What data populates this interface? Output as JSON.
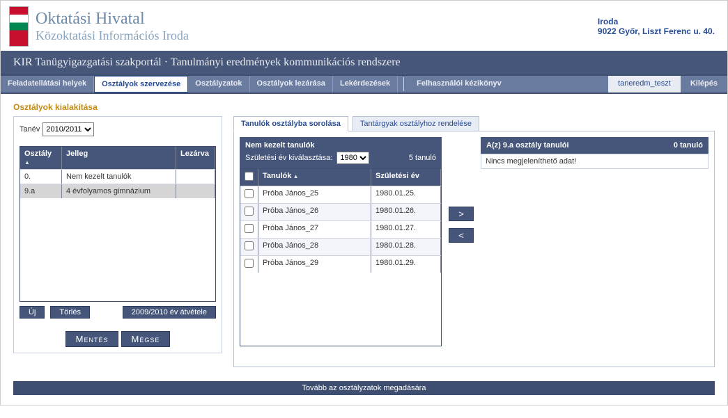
{
  "header": {
    "title": "Oktatási Hivatal",
    "subtitle": "Közoktatási Információs Iroda",
    "dept": "Iroda",
    "address": "9022 Győr, Liszt Ferenc u. 40."
  },
  "crumb": "KIR Tanügyigazgatási szakportál · Tanulmányi eredmények kommunikációs rendszere",
  "nav": {
    "items": [
      "Feladatellátási helyek",
      "Osztályok szervezése",
      "Osztályzatok",
      "Osztályok lezárása",
      "Lekérdezések",
      "Felhasználói kézikönyv"
    ],
    "active_index": 1,
    "user": "taneredm_teszt",
    "logout": "Kilépés"
  },
  "section_title": "Osztályok kialakítása",
  "year": {
    "label": "Tanév",
    "value": "2010/2011",
    "options": [
      "2010/2011"
    ]
  },
  "class_grid": {
    "headers": [
      "Osztály",
      "Jelleg",
      "Lezárva"
    ],
    "rows": [
      {
        "class": "0.",
        "type": "Nem kezelt tanulók",
        "closed": ""
      },
      {
        "class": "9.a",
        "type": "4 évfolyamos gimnázium",
        "closed": ""
      }
    ],
    "selected_index": 1
  },
  "class_buttons": {
    "new": "Új",
    "delete": "Törlés",
    "import": "2009/2010 év átvétele"
  },
  "save_buttons": {
    "save": "Mentés",
    "cancel": "Mégse"
  },
  "tabs": {
    "items": [
      "Tanulók osztályba sorolása",
      "Tantárgyak osztályhoz rendelése"
    ],
    "active_index": 0
  },
  "students_panel": {
    "title": "Nem kezelt tanulók",
    "birth_label": "Születési év kiválasztása:",
    "birth_value": "1980",
    "birth_options": [
      "1980"
    ],
    "count_text": "5 tanuló",
    "headers": [
      "Tanulók",
      "Születési év"
    ],
    "rows": [
      {
        "name": "Próba János_25",
        "dob": "1980.01.25."
      },
      {
        "name": "Próba János_26",
        "dob": "1980.01.26."
      },
      {
        "name": "Próba János_27",
        "dob": "1980.01.27."
      },
      {
        "name": "Próba János_28",
        "dob": "1980.01.28."
      },
      {
        "name": "Próba János_29",
        "dob": "1980.01.29."
      }
    ]
  },
  "target_panel": {
    "title": "A(z) 9.a osztály tanulói",
    "count_text": "0 tanuló",
    "empty_text": "Nincs megjeleníthető adat!"
  },
  "footer": "Tovább az osztályzatok megadására"
}
